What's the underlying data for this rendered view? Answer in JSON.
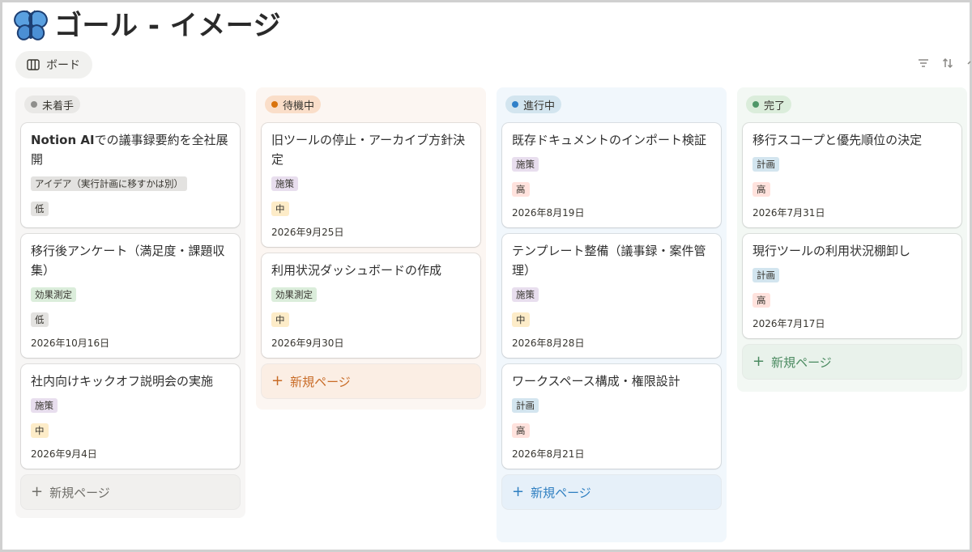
{
  "page": {
    "icon": "butterfly-icon",
    "title": "ゴール - イメージ"
  },
  "view": {
    "icon": "board-icon",
    "label": "ボード"
  },
  "toolbar": {
    "icons": [
      "filter-icon",
      "sort-icon",
      "more-icon"
    ]
  },
  "colors": {
    "tag_gray": "#e3e2e0",
    "tag_purple": "#e8deee",
    "tag_green": "#dbeddb",
    "tag_blue": "#d3e5ef",
    "tag_red": "#ffe2dd",
    "tag_yellow": "#fdecc8"
  },
  "columns": [
    {
      "name": "未着手",
      "pill_bg": "#e9e8e6",
      "dot": "#8f8f8c",
      "new_color": "#6f6e69",
      "new_bg": "#f1f0ee",
      "new_label": "新規ページ",
      "cards": [
        {
          "title_bold": "Notion AI",
          "title": "での議事録要約を全社展開",
          "category": "アイデア（実行計画に移すかは別）",
          "category_color": "#e3e2e0",
          "priority": "低",
          "priority_color": "#e3e2e0",
          "date": ""
        },
        {
          "title_bold": "",
          "title": "移行後アンケート（満足度・課題収集）",
          "category": "効果測定",
          "category_color": "#dbeddb",
          "priority": "低",
          "priority_color": "#e3e2e0",
          "date": "2026年10月16日"
        },
        {
          "title_bold": "",
          "title": "社内向けキックオフ説明会の実施",
          "category": "施策",
          "category_color": "#e8deee",
          "priority": "中",
          "priority_color": "#fdecc8",
          "date": "2026年9月4日"
        }
      ]
    },
    {
      "name": "待機中",
      "pill_bg": "#fadec9",
      "dot": "#d9730d",
      "new_color": "#c86b26",
      "new_bg": "#fbeee4",
      "new_label": "新規ページ",
      "cards": [
        {
          "title_bold": "",
          "title": "旧ツールの停止・アーカイブ方針決定",
          "category": "施策",
          "category_color": "#e8deee",
          "priority": "中",
          "priority_color": "#fdecc8",
          "date": "2026年9月25日"
        },
        {
          "title_bold": "",
          "title": "利用状況ダッシュボードの作成",
          "category": "効果測定",
          "category_color": "#dbeddb",
          "priority": "中",
          "priority_color": "#fdecc8",
          "date": "2026年9月30日"
        }
      ]
    },
    {
      "name": "進行中",
      "pill_bg": "#d3e5ef",
      "dot": "#2f80c8",
      "new_color": "#2f7fc1",
      "new_bg": "#e6f0f9",
      "new_label": "新規ページ",
      "cards": [
        {
          "title_bold": "",
          "title": "既存ドキュメントのインポート検証",
          "category": "施策",
          "category_color": "#e8deee",
          "priority": "高",
          "priority_color": "#ffe2dd",
          "date": "2026年8月19日"
        },
        {
          "title_bold": "",
          "title": "テンプレート整備（議事録・案件管理）",
          "category": "施策",
          "category_color": "#e8deee",
          "priority": "中",
          "priority_color": "#fdecc8",
          "date": "2026年8月28日"
        },
        {
          "title_bold": "",
          "title": "ワークスペース構成・権限設計",
          "category": "計画",
          "category_color": "#d3e5ef",
          "priority": "高",
          "priority_color": "#ffe2dd",
          "date": "2026年8月21日"
        }
      ]
    },
    {
      "name": "完了",
      "pill_bg": "#dbeddb",
      "dot": "#4f9768",
      "new_color": "#4a8a60",
      "new_bg": "#e9f2eb",
      "new_label": "新規ページ",
      "cards": [
        {
          "title_bold": "",
          "title": "移行スコープと優先順位の決定",
          "category": "計画",
          "category_color": "#d3e5ef",
          "priority": "高",
          "priority_color": "#ffe2dd",
          "date": "2026年7月31日"
        },
        {
          "title_bold": "",
          "title": "現行ツールの利用状況棚卸し",
          "category": "計画",
          "category_color": "#d3e5ef",
          "priority": "高",
          "priority_color": "#ffe2dd",
          "date": "2026年7月17日"
        }
      ]
    }
  ]
}
